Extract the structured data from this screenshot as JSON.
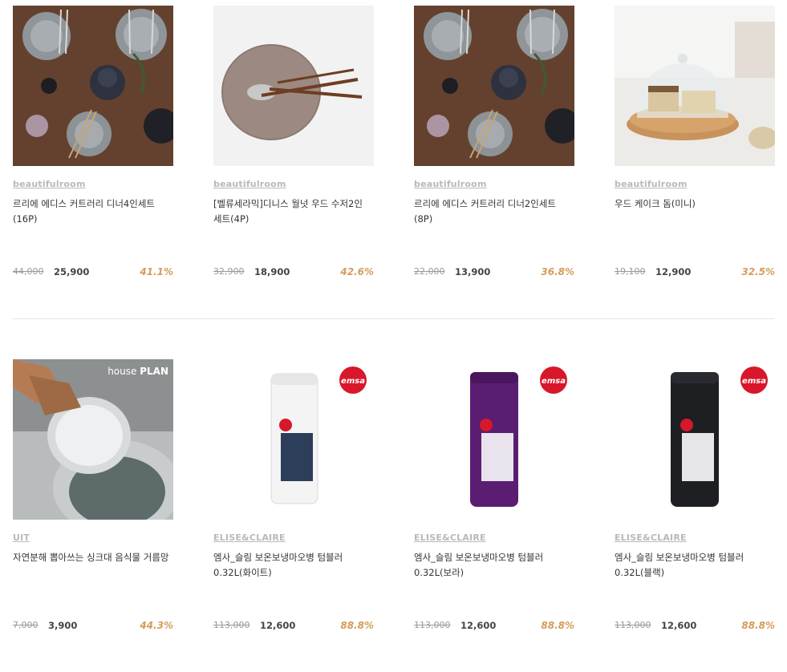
{
  "products_row1": [
    {
      "brand": "beautifulroom",
      "name": "르리에 에디스 커트러리 디너4인세트 (16P)",
      "original_price": "44,000",
      "sale_price": "25,900",
      "discount": "41.1%",
      "image": "tableware-dinner-set-photo"
    },
    {
      "brand": "beautifulroom",
      "name": "[벨류세라믹]디니스 월넛 우드 수저2인 세트(4P)",
      "original_price": "32,900",
      "sale_price": "18,900",
      "discount": "42.6%",
      "image": "walnut-cutlery-photo"
    },
    {
      "brand": "beautifulroom",
      "name": "르리에 에디스 커트러리 디너2인세트 (8P)",
      "original_price": "22,000",
      "sale_price": "13,900",
      "discount": "36.8%",
      "image": "tableware-dinner-set-photo"
    },
    {
      "brand": "beautifulroom",
      "name": "우드 케이크 돔(미니)",
      "original_price": "19,100",
      "sale_price": "12,900",
      "discount": "32.5%",
      "image": "cake-dome-photo"
    }
  ],
  "products_row2": [
    {
      "brand": "UIT",
      "name": "자연분해 뽑아쓰는 싱크대 음식물 거름망",
      "original_price": "7,000",
      "sale_price": "3,900",
      "discount": "44.3%",
      "image": "sink-strainer-photo",
      "image_text": "house",
      "image_text_bold": "PLAN"
    },
    {
      "brand": "ELISE&CLAIRE",
      "name": "엠사_슬림 보온보냉마오병 텀블러 0.32L(화이트)",
      "original_price": "113,000",
      "sale_price": "12,600",
      "discount": "88.8%",
      "image": "tumbler-white-photo",
      "logo_text": "emsa"
    },
    {
      "brand": "ELISE&CLAIRE",
      "name": "엠사_슬림 보온보냉마오병 텀블러 0.32L(보라)",
      "original_price": "113,000",
      "sale_price": "12,600",
      "discount": "88.8%",
      "image": "tumbler-purple-photo",
      "logo_text": "emsa"
    },
    {
      "brand": "ELISE&CLAIRE",
      "name": "엠사_슬림 보온보냉마오병 텀블러 0.32L(블랙)",
      "original_price": "113,000",
      "sale_price": "12,600",
      "discount": "88.8%",
      "image": "tumbler-black-photo",
      "logo_text": "emsa"
    }
  ],
  "colors": {
    "discount": "#d49c5a",
    "brand": "#b9b9b9",
    "emsa_red": "#d8172a"
  }
}
